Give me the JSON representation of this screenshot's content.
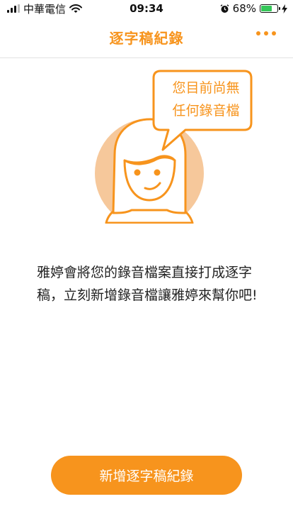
{
  "status_bar": {
    "carrier": "中華電信",
    "time": "09:34",
    "battery_percent": "68%",
    "battery_level": 0.68,
    "icons": [
      "signal-icon",
      "wifi-icon",
      "alarm-icon",
      "battery-icon",
      "charging-icon"
    ]
  },
  "nav": {
    "title": "逐字稿紀錄",
    "more_icon": "more-dots-icon"
  },
  "empty_state": {
    "bubble_line1": "您目前尚無",
    "bubble_line2": "任何錄音檔",
    "description": "雅婷會將您的錄音檔案直接打成逐字稿，立刻新增錄音檔讓雅婷來幫你吧!"
  },
  "actions": {
    "add_button_label": "新增逐字稿紀錄"
  },
  "colors": {
    "accent": "#f7941d",
    "avatar_bg": "#f6c89b",
    "battery_fill": "#35c759"
  }
}
